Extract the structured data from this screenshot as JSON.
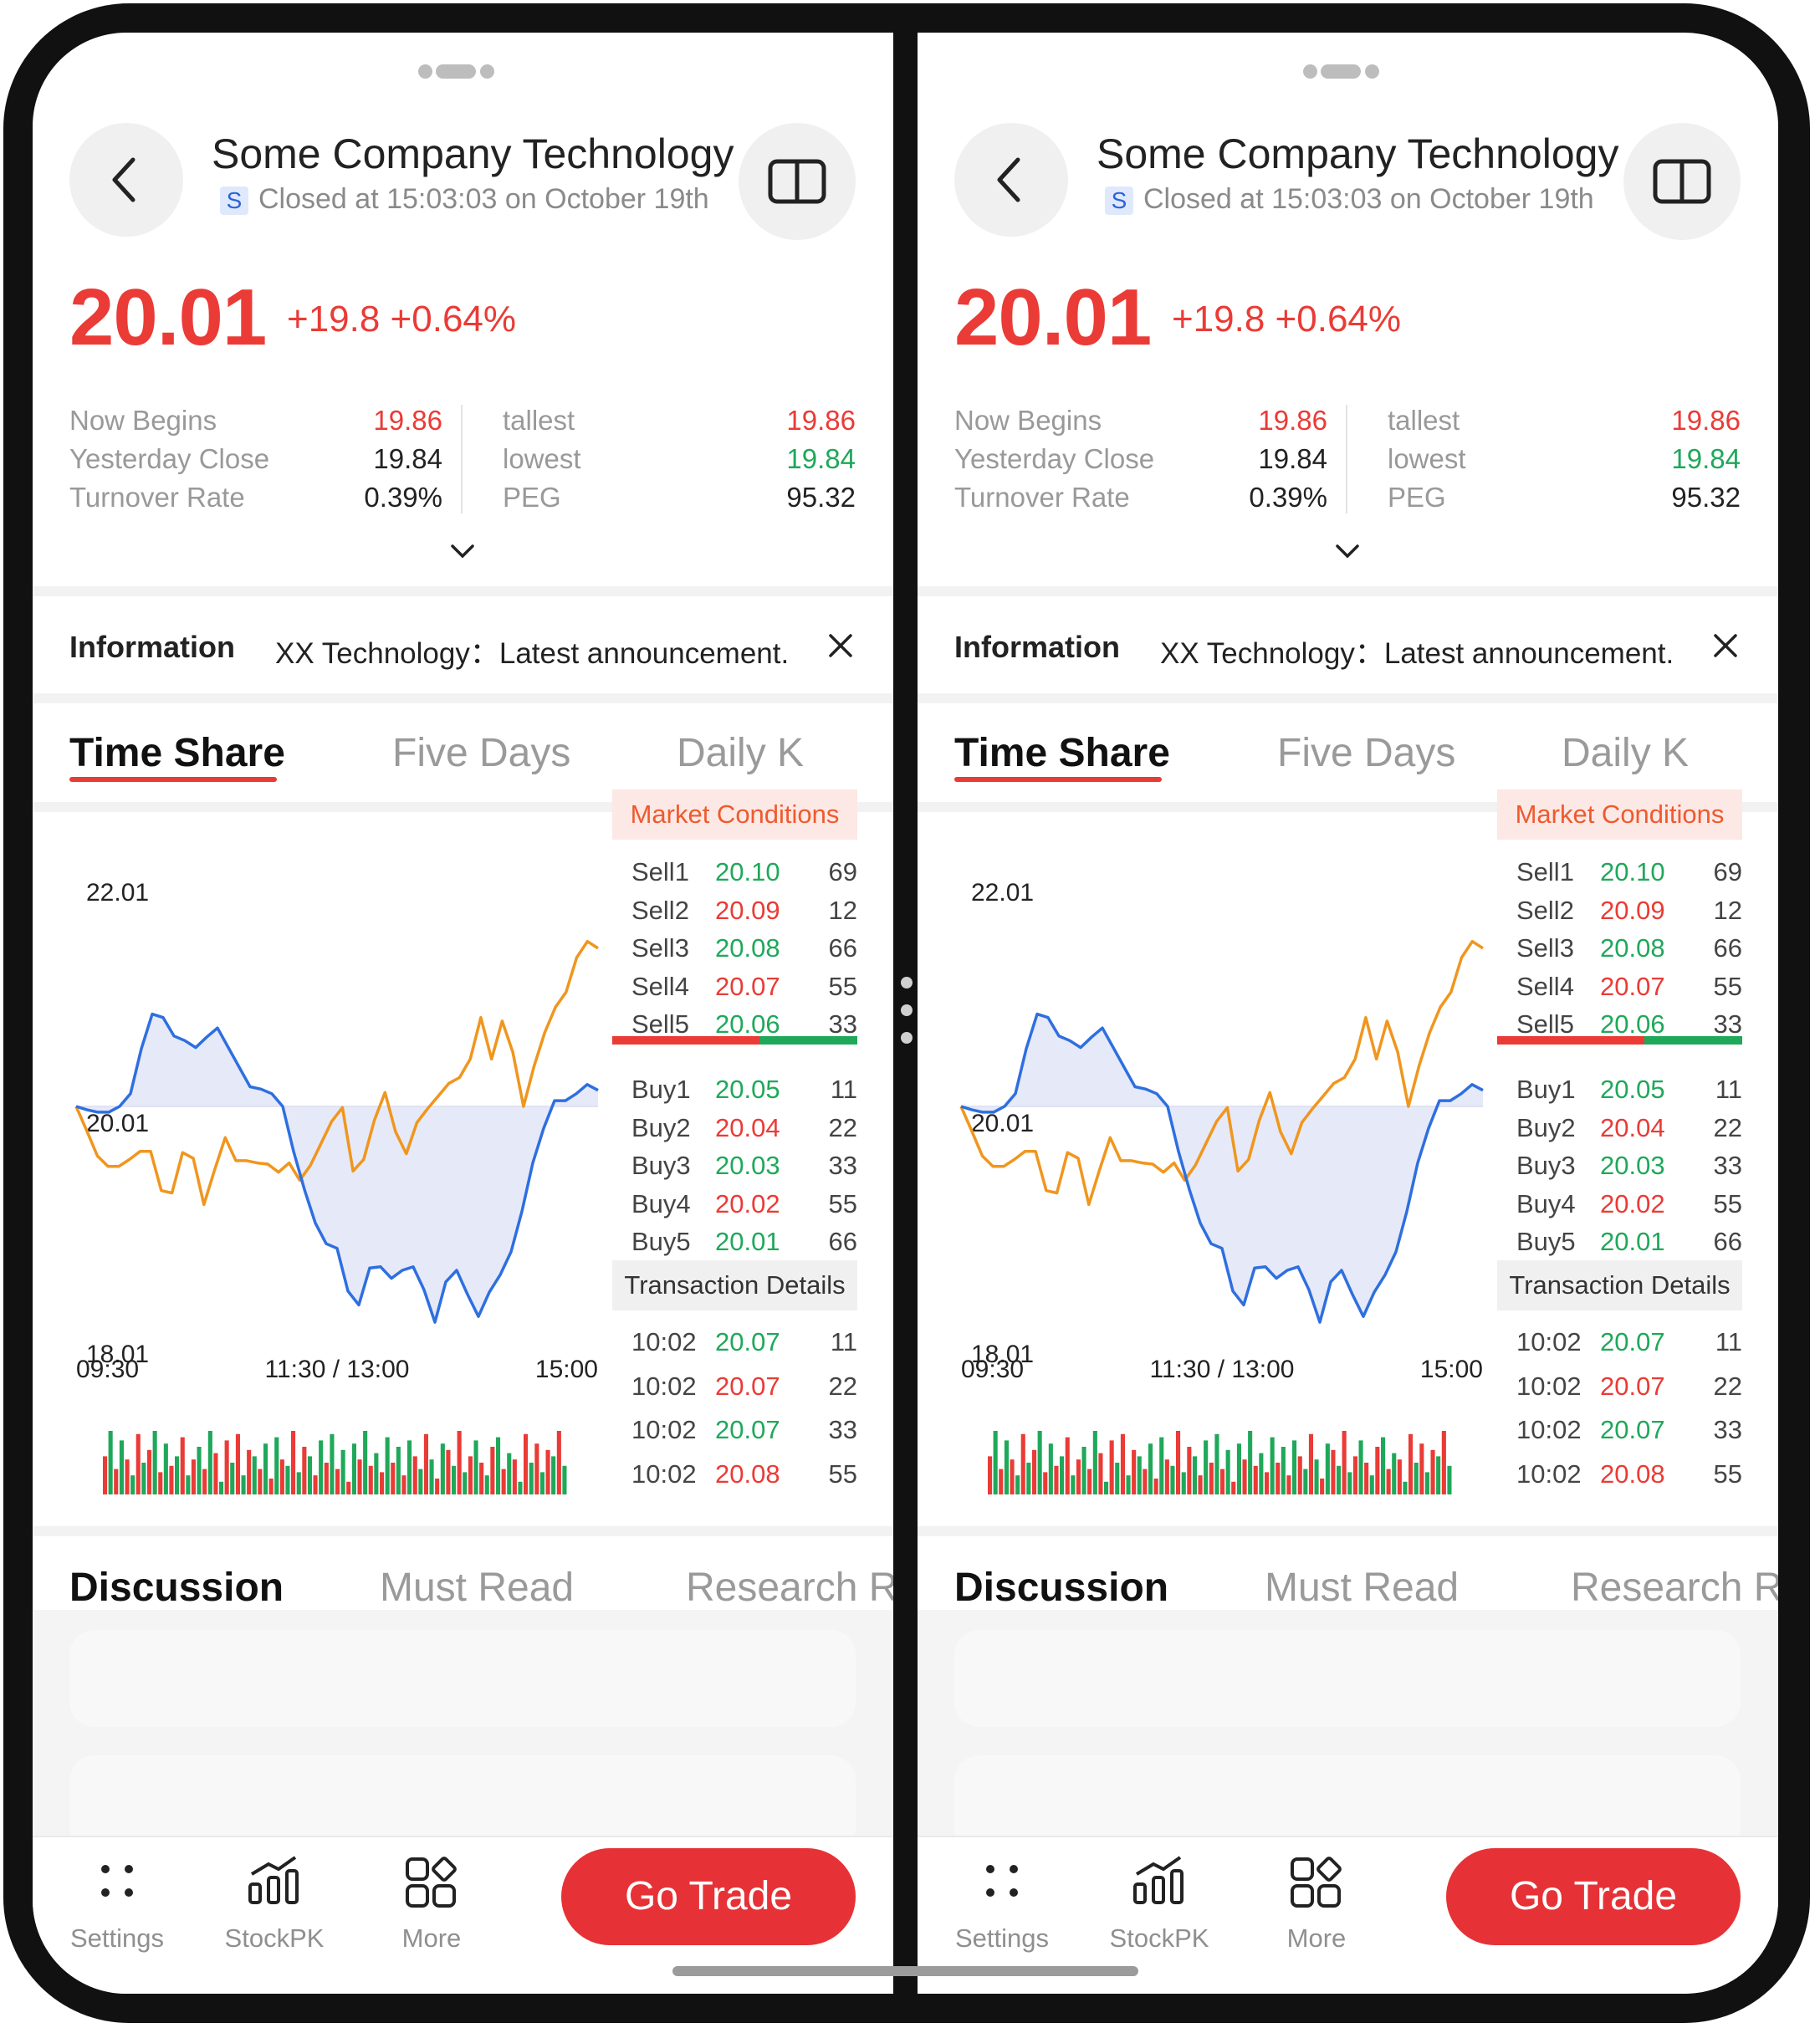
{
  "header": {
    "title": "Some Company Technology",
    "badge": "S",
    "status": "Closed at 15:03:03 on October 19th"
  },
  "quote": {
    "price": "20.01",
    "change": "+19.8 +0.64%",
    "left": [
      {
        "label": "Now Begins",
        "value": "19.86",
        "color": "#ea3b36"
      },
      {
        "label": "Yesterday Close",
        "value": "19.84",
        "color": "#222222"
      },
      {
        "label": "Turnover Rate",
        "value": "0.39%",
        "color": "#222222"
      }
    ],
    "right": [
      {
        "label": "tallest",
        "value": "19.86",
        "color": "#ea3b36"
      },
      {
        "label": "lowest",
        "value": "19.84",
        "color": "#1fa85a"
      },
      {
        "label": "PEG",
        "value": "95.32",
        "color": "#222222"
      }
    ],
    "expand_icon": "chevron-down-icon"
  },
  "info": {
    "title": "Information",
    "text": "XX Technology：Latest announcement.",
    "close_icon": "close-icon"
  },
  "chart_tabs": [
    "Time Share",
    "Five Days",
    "Daily K"
  ],
  "chart_data": {
    "type": "line",
    "title": "",
    "y_ticks": [
      "22.01",
      "20.01",
      "18.01"
    ],
    "ylim": [
      18.01,
      22.01
    ],
    "reference": 20.01,
    "x_ticks": [
      "09:30",
      "11:30 / 13:00",
      "15:00"
    ],
    "series": [
      {
        "color": "#2e6fe0",
        "fill": "#e6e9f7",
        "values": [
          20.01,
          19.98,
          19.96,
          19.96,
          20.01,
          20.12,
          20.51,
          20.81,
          20.78,
          20.62,
          20.58,
          20.52,
          20.61,
          20.69,
          20.52,
          20.35,
          20.18,
          20.16,
          20.12,
          20.01,
          19.62,
          19.29,
          19.0,
          18.82,
          18.78,
          18.41,
          18.29,
          18.61,
          18.62,
          18.52,
          18.59,
          18.62,
          18.42,
          18.14,
          18.49,
          18.59,
          18.38,
          18.19,
          18.4,
          18.55,
          18.75,
          19.1,
          19.52,
          19.82,
          20.06,
          20.06,
          20.12,
          20.2,
          20.15
        ]
      },
      {
        "color": "#f0961e",
        "values": [
          20.01,
          19.8,
          19.58,
          19.49,
          19.49,
          19.55,
          19.62,
          19.62,
          19.28,
          19.26,
          19.61,
          19.56,
          19.16,
          19.46,
          19.74,
          19.54,
          19.54,
          19.52,
          19.51,
          19.44,
          19.52,
          19.37,
          19.5,
          19.69,
          19.88,
          20.0,
          19.45,
          19.55,
          19.89,
          20.13,
          19.79,
          19.6,
          19.87,
          19.99,
          20.1,
          20.21,
          20.26,
          20.42,
          20.78,
          20.42,
          20.75,
          20.48,
          20.01,
          20.36,
          20.65,
          20.87,
          21.0,
          21.3,
          21.44,
          21.38
        ]
      }
    ],
    "volume": {
      "colors": [
        "#ea3b36",
        "#1fa85a"
      ],
      "values": [
        0.6,
        1,
        0.4,
        0.85,
        0.55,
        0.3,
        0.95,
        0.5,
        0.7,
        1,
        0.35,
        0.8,
        0.45,
        0.6,
        0.9,
        0.3,
        0.55,
        0.75,
        0.4,
        1,
        0.65,
        0.2,
        0.85,
        0.5,
        0.95,
        0.3,
        0.7,
        0.6,
        0.4,
        0.8,
        0.25,
        0.9,
        0.55,
        0.45,
        1,
        0.35,
        0.75,
        0.6,
        0.3,
        0.85,
        0.5,
        0.95,
        0.4,
        0.7,
        0.2,
        0.8,
        0.55,
        1,
        0.45,
        0.65,
        0.35,
        0.9,
        0.5,
        0.75,
        0.3,
        0.85,
        0.6,
        0.4,
        0.95,
        0.55,
        0.25,
        0.8,
        0.7,
        0.45,
        1,
        0.35,
        0.6,
        0.85,
        0.5,
        0.3,
        0.75,
        0.9,
        0.4,
        0.65,
        0.55,
        0.2,
        0.95,
        0.5,
        0.8,
        0.35,
        0.7,
        0.6,
        1,
        0.45
      ]
    }
  },
  "orderbook": {
    "title": "Market Conditions",
    "sells": [
      {
        "label": "Sell1",
        "price": "20.10",
        "vol": "69",
        "color": "#1fa85a"
      },
      {
        "label": "Sell2",
        "price": "20.09",
        "vol": "12",
        "color": "#ea3b36"
      },
      {
        "label": "Sell3",
        "price": "20.08",
        "vol": "66",
        "color": "#1fa85a"
      },
      {
        "label": "Sell4",
        "price": "20.07",
        "vol": "55",
        "color": "#ea3b36"
      },
      {
        "label": "Sell5",
        "price": "20.06",
        "vol": "33",
        "color": "#1fa85a"
      }
    ],
    "buys": [
      {
        "label": "Buy1",
        "price": "20.05",
        "vol": "11",
        "color": "#1fa85a"
      },
      {
        "label": "Buy2",
        "price": "20.04",
        "vol": "22",
        "color": "#ea3b36"
      },
      {
        "label": "Buy3",
        "price": "20.03",
        "vol": "33",
        "color": "#1fa85a"
      },
      {
        "label": "Buy4",
        "price": "20.02",
        "vol": "55",
        "color": "#ea3b36"
      },
      {
        "label": "Buy5",
        "price": "20.01",
        "vol": "66",
        "color": "#1fa85a"
      }
    ],
    "split": {
      "sell_fraction": 0.6,
      "sell_color": "#ea3b36",
      "buy_color": "#1fa85a"
    }
  },
  "transactions": {
    "title": "Transaction Details",
    "rows": [
      {
        "time": "10:02",
        "price": "20.07",
        "vol": "11",
        "color": "#1fa85a"
      },
      {
        "time": "10:02",
        "price": "20.07",
        "vol": "22",
        "color": "#ea3b36"
      },
      {
        "time": "10:02",
        "price": "20.07",
        "vol": "33",
        "color": "#1fa85a"
      },
      {
        "time": "10:02",
        "price": "20.08",
        "vol": "55",
        "color": "#ea3b36"
      }
    ]
  },
  "discussion_tabs": [
    "Discussion",
    "Must Read",
    "Research Re"
  ],
  "bottom_nav": [
    {
      "label": "Settings",
      "icon": "dots-grid-icon"
    },
    {
      "label": "StockPK",
      "icon": "bar-chart-icon"
    },
    {
      "label": "More",
      "icon": "apps-icon"
    }
  ],
  "trade_button": "Go Trade",
  "accent_color": "#e63236"
}
